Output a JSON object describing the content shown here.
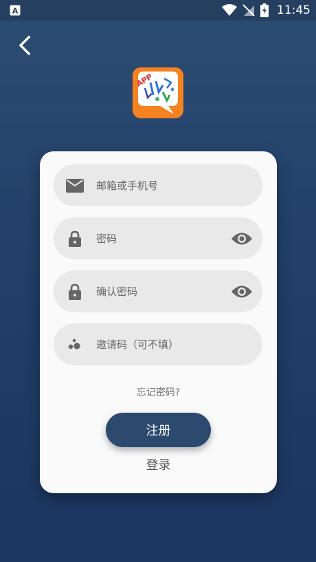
{
  "status_bar": {
    "time": "11:45",
    "icons": [
      "notification-a-icon",
      "wifi-icon",
      "no-signal-icon",
      "battery-charging-icon"
    ]
  },
  "nav": {
    "back_icon": "chevron-left-icon"
  },
  "logo": {
    "label": "APP"
  },
  "form": {
    "fields": [
      {
        "placeholder": "邮箱或手机号",
        "value": "",
        "icon": "mail-icon"
      },
      {
        "placeholder": "密码",
        "value": "",
        "icon": "lock-icon",
        "toggle_icon": "eye-icon"
      },
      {
        "placeholder": "确认密码",
        "value": "",
        "icon": "lock-icon",
        "toggle_icon": "eye-icon"
      },
      {
        "placeholder": "邀请码（可不填）",
        "value": "",
        "icon": "invite-icon"
      }
    ],
    "forgot_password": "忘记密码?",
    "register_button": "注册",
    "login_link": "登录"
  },
  "colors": {
    "background_top": "#2c4d72",
    "background_bottom": "#1b3660",
    "card": "#fafafa",
    "field": "#e9e9ea",
    "primary_button": "#2c4a6e",
    "logo_bg": "#f58220"
  }
}
